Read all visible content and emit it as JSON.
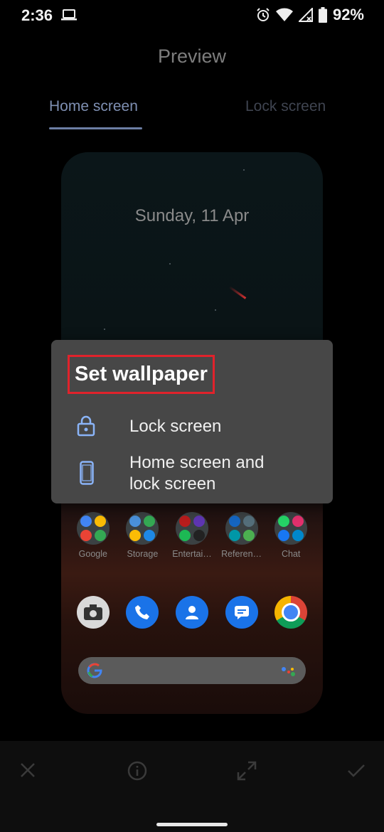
{
  "status_bar": {
    "time": "2:36",
    "battery_percent": "92%",
    "icons": [
      "laptop-icon",
      "alarm-icon",
      "wifi-icon",
      "signal-icon",
      "battery-icon"
    ]
  },
  "header": {
    "title": "Preview"
  },
  "tabs": [
    {
      "label": "Home screen",
      "selected": true
    },
    {
      "label": "Lock screen",
      "selected": false
    }
  ],
  "preview": {
    "date": "Sunday, 11 Apr",
    "apps": [
      {
        "label": "Google",
        "icon": "google-folder-icon"
      },
      {
        "label": "Storage",
        "icon": "storage-folder-icon"
      },
      {
        "label": "Entertai…",
        "icon": "entertainment-folder-icon"
      },
      {
        "label": "Referen…",
        "icon": "reference-folder-icon"
      },
      {
        "label": "Chat",
        "icon": "chat-folder-icon"
      }
    ],
    "dock": [
      "camera-go-icon",
      "phone-icon",
      "contacts-icon",
      "messages-icon",
      "chrome-icon"
    ],
    "search_icons": [
      "google-g-icon",
      "assistant-icon"
    ]
  },
  "dialog": {
    "title": "Set wallpaper",
    "options": [
      {
        "label": "Lock screen",
        "icon": "lock-icon"
      },
      {
        "label_line1": "Home screen and",
        "label_line2": "lock screen",
        "icon": "phone-outline-icon"
      }
    ]
  },
  "bottom_bar": {
    "icons": [
      "close-icon",
      "info-icon",
      "fullscreen-icon",
      "check-icon"
    ]
  },
  "colors": {
    "dialog_bg": "#474747",
    "highlight_border": "#e0222b",
    "tab_active": "#7e8fb2",
    "icon_blue": "#8ab4f8"
  }
}
